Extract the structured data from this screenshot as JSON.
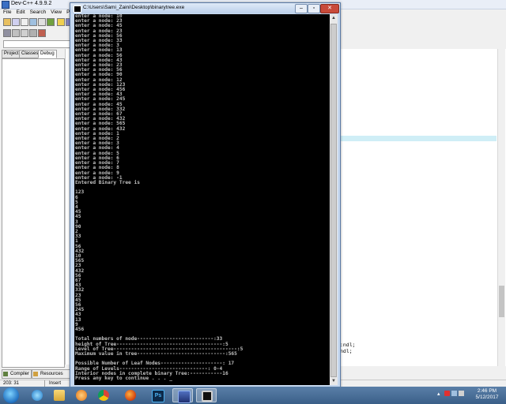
{
  "ide": {
    "title": "Dev-C++ 4.9.9.2",
    "menu": [
      "File",
      "Edit",
      "Search",
      "View",
      "P"
    ],
    "left_tabs": [
      "Project",
      "Classes",
      "Debug"
    ],
    "editor_fragments": [
      ":ndl;",
      "ndl;"
    ],
    "bottom_tabs": [
      "Compiler",
      "Resources"
    ],
    "status": {
      "position": "203: 31",
      "mode": "Insert"
    }
  },
  "console": {
    "title": "C:\\Users\\Sami_Zaini\\Desktop\\binarytree.exe",
    "lines": [
      "enter a node: 10",
      "enter a node: 23",
      "enter a node: 45",
      "enter a node: 23",
      "enter a node: 56",
      "enter a node: 33",
      "enter a node: 3",
      "enter a node: 13",
      "enter a node: 56",
      "enter a node: 43",
      "enter a node: 23",
      "enter a node: 56",
      "enter a node: 90",
      "enter a node: 12",
      "enter a node: 123",
      "enter a node: 456",
      "enter a node: 43",
      "enter a node: 245",
      "enter a node: 45",
      "enter a node: 332",
      "enter a node: 67",
      "enter a node: 432",
      "enter a node: 565",
      "enter a node: 432",
      "enter a node: 1",
      "enter a node: 2",
      "enter a node: 3",
      "enter a node: 4",
      "enter a node: 5",
      "enter a node: 6",
      "enter a node: 7",
      "enter a node: 8",
      "enter a node: 9",
      "enter a node: -1",
      "Entered Binary Tree is",
      "",
      "123",
      "6",
      "5",
      "4",
      "45",
      "45",
      "3",
      "90",
      "2",
      "33",
      "1",
      "56",
      "432",
      "10",
      "565",
      "23",
      "432",
      "56",
      "67",
      "43",
      "332",
      "23",
      "45",
      "56",
      "245",
      "43",
      "13",
      "9",
      "456",
      "",
      "Total numbers of node--------------------------:33",
      "height of Tree------------------------------------:5",
      "Level of Tree------------------------------------------:5",
      "Maximum value in tree------------------------------:565",
      "",
      "Possible Number of Leaf Nodes---------------------: 17",
      "Range of Levels------------------------------: 0-4",
      "Interior nodes in complete binary Tree:-----------16",
      "Press any key to continue . . . _"
    ]
  },
  "taskbar": {
    "apps": [
      "ie-icon",
      "explorer-icon",
      "media-player-icon",
      "chrome-icon",
      "firefox-icon",
      "photoshop-icon",
      "devcpp-icon",
      "console-icon"
    ],
    "photoshop_label": "Ps",
    "clock_time": "2:46 PM",
    "clock_date": "5/12/2017"
  },
  "colors": {
    "console_bg": "#000000",
    "console_text": "#c0c0c0",
    "taskbar": "#3a5f88",
    "close_button": "#c84a3a"
  }
}
